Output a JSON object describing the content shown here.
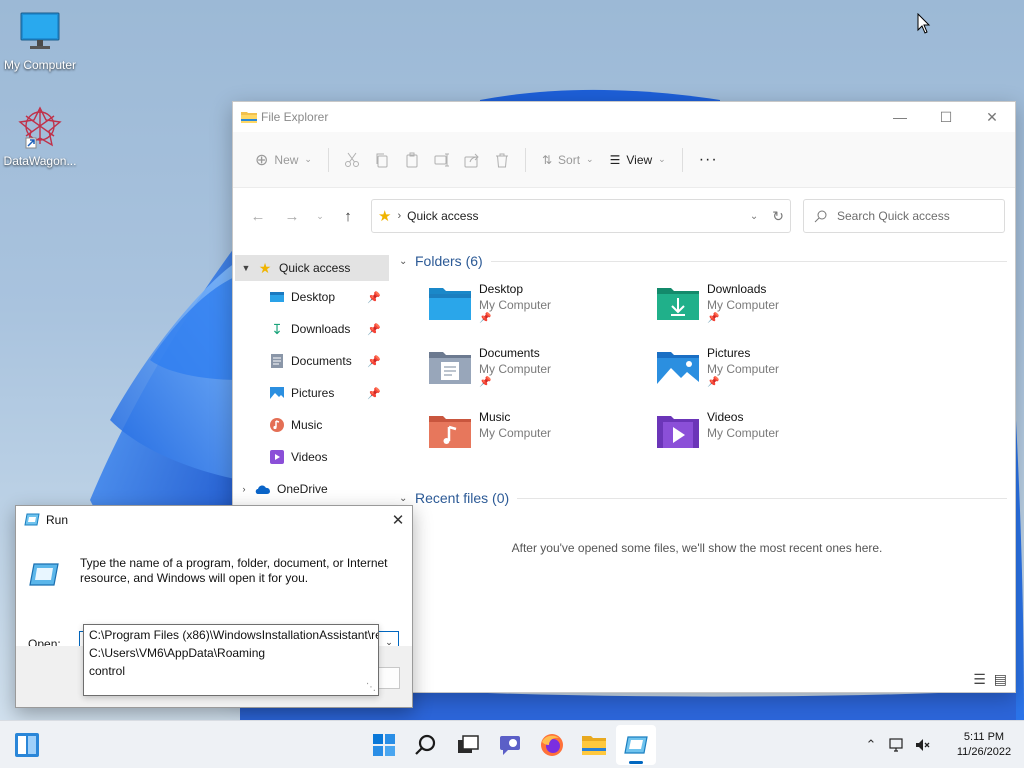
{
  "desktop": {
    "icons": [
      {
        "label": "My Computer"
      },
      {
        "label": "DataWagon..."
      }
    ]
  },
  "explorer": {
    "title": "File Explorer",
    "toolbar": {
      "new_label": "New",
      "sort_label": "Sort",
      "view_label": "View"
    },
    "address": {
      "path": "Quick access",
      "search_placeholder": "Search Quick access"
    },
    "nav": {
      "quick_access": "Quick access",
      "items": [
        {
          "label": "Desktop",
          "pinned": true
        },
        {
          "label": "Downloads",
          "pinned": true
        },
        {
          "label": "Documents",
          "pinned": true
        },
        {
          "label": "Pictures",
          "pinned": true
        },
        {
          "label": "Music",
          "pinned": false
        },
        {
          "label": "Videos",
          "pinned": false
        }
      ],
      "onedrive": "OneDrive"
    },
    "folders_header": "Folders (6)",
    "folders": [
      {
        "name": "Desktop",
        "location": "My Computer",
        "pinned": true,
        "icon": "desktop-folder-icon"
      },
      {
        "name": "Downloads",
        "location": "My Computer",
        "pinned": true,
        "icon": "downloads-folder-icon"
      },
      {
        "name": "Documents",
        "location": "My Computer",
        "pinned": true,
        "icon": "documents-folder-icon"
      },
      {
        "name": "Pictures",
        "location": "My Computer",
        "pinned": true,
        "icon": "pictures-folder-icon"
      },
      {
        "name": "Music",
        "location": "My Computer",
        "pinned": false,
        "icon": "music-folder-icon"
      },
      {
        "name": "Videos",
        "location": "My Computer",
        "pinned": false,
        "icon": "videos-folder-icon"
      }
    ],
    "recent_header": "Recent files (0)",
    "recent_empty": "After you've opened some files, we'll show the most recent ones here."
  },
  "run": {
    "title": "Run",
    "description": "Type the name of a program, folder, document, or Internet resource, and Windows will open it for you.",
    "open_label_prefix": "O",
    "open_label_rest": "pen:",
    "input_value": "c",
    "autocomplete": [
      "C:\\Program Files (x86)\\WindowsInstallationAssistant\\re",
      "C:\\Users\\VM6\\AppData\\Roaming",
      "control"
    ]
  },
  "taskbar": {
    "apps": [
      "start-icon",
      "search-icon",
      "task-view-icon",
      "chat-icon",
      "firefox-icon",
      "file-explorer-icon",
      "run-icon"
    ],
    "active_app": "run-icon",
    "clock_time": "5:11 PM",
    "clock_date": "11/26/2022"
  },
  "colors": {
    "accent": "#0067c0",
    "section_header": "#2c5a96"
  }
}
